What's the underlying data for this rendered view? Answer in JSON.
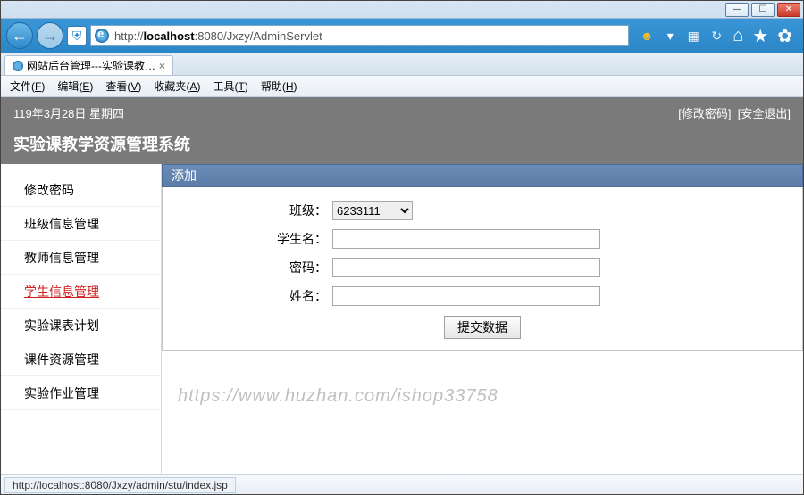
{
  "window_buttons": {
    "min": "—",
    "max": "☐",
    "close": "✕"
  },
  "url": {
    "pre": "http://",
    "host": "localhost",
    "port": ":8080",
    "path": "/Jxzy/AdminServlet"
  },
  "chrome_icons": {
    "smiley": "☻",
    "down": "▾",
    "grid": "▦",
    "refresh": "↻"
  },
  "right_tools": {
    "home": "⌂",
    "star": "★",
    "gear": "✿"
  },
  "tab": {
    "title": "网站后台管理---实验课教…",
    "close": "×"
  },
  "menu": {
    "file": "文件",
    "file_u": "F",
    "edit": "编辑",
    "edit_u": "E",
    "view": "查看",
    "view_u": "V",
    "fav": "收藏夹",
    "fav_u": "A",
    "tool": "工具",
    "tool_u": "T",
    "help": "帮助",
    "help_u": "H"
  },
  "band": {
    "date": "119年3月28日 星期四",
    "change_pwd": "[修改密码]",
    "logout": "[安全退出]",
    "title": "实验课教学资源管理系统"
  },
  "sidebar": {
    "items": [
      {
        "label": "修改密码"
      },
      {
        "label": "班级信息管理"
      },
      {
        "label": "教师信息管理"
      },
      {
        "label": "学生信息管理"
      },
      {
        "label": "实验课表计划"
      },
      {
        "label": "课件资源管理"
      },
      {
        "label": "实验作业管理"
      }
    ],
    "active_index": 3
  },
  "panel": {
    "title": "添加",
    "labels": {
      "class": "班级：",
      "username": "学生名：",
      "password": "密码：",
      "realname": "姓名："
    },
    "class_selected": "6233111",
    "submit": "提交数据"
  },
  "watermark": "https://www.huzhan.com/ishop33758",
  "status": "http://localhost:8080/Jxzy/admin/stu/index.jsp"
}
